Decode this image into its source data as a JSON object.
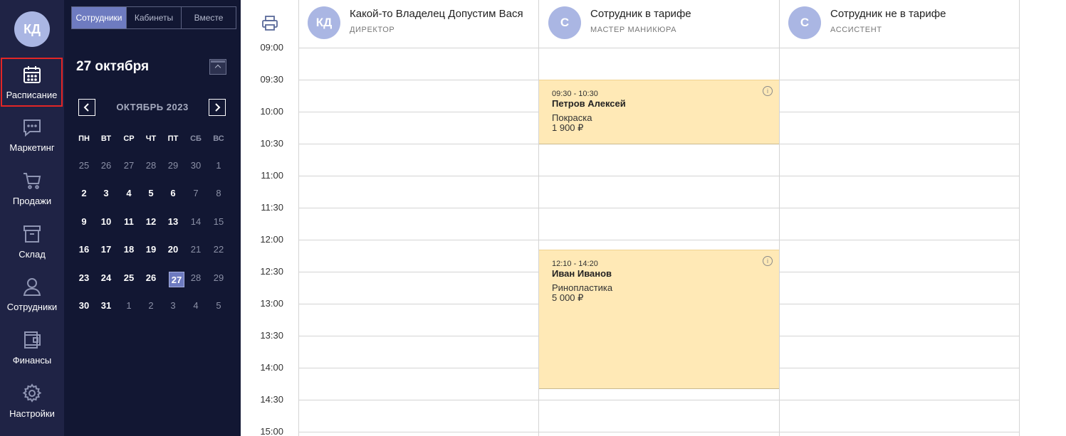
{
  "nav": {
    "avatar": "КД",
    "items": [
      {
        "label": "Расписание",
        "icon": "calendar-icon"
      },
      {
        "label": "Маркетинг",
        "icon": "chat-icon"
      },
      {
        "label": "Продажи",
        "icon": "cart-icon"
      },
      {
        "label": "Склад",
        "icon": "archive-icon"
      },
      {
        "label": "Сотрудники",
        "icon": "person-icon"
      },
      {
        "label": "Финансы",
        "icon": "wallet-icon"
      },
      {
        "label": "Настройки",
        "icon": "gear-icon"
      }
    ],
    "active": "Расписание"
  },
  "panel": {
    "tabs": [
      "Сотрудники",
      "Кабинеты",
      "Вместе"
    ],
    "active_tab": "Сотрудники",
    "date_title": "27 октября",
    "month_label": "ОКТЯБРЬ 2023",
    "weekdays": [
      "ПН",
      "ВТ",
      "СР",
      "ЧТ",
      "ПТ",
      "СБ",
      "ВС"
    ],
    "weeks": [
      [
        "25",
        "26",
        "27",
        "28",
        "29",
        "30",
        "1"
      ],
      [
        "2",
        "3",
        "4",
        "5",
        "6",
        "7",
        "8"
      ],
      [
        "9",
        "10",
        "11",
        "12",
        "13",
        "14",
        "15"
      ],
      [
        "16",
        "17",
        "18",
        "19",
        "20",
        "21",
        "22"
      ],
      [
        "23",
        "24",
        "25",
        "26",
        "27",
        "28",
        "29"
      ],
      [
        "30",
        "31",
        "1",
        "2",
        "3",
        "4",
        "5"
      ]
    ],
    "selected_day": "27"
  },
  "schedule": {
    "times": [
      "09:00",
      "09:30",
      "10:00",
      "10:30",
      "11:00",
      "11:30",
      "12:00",
      "12:30",
      "13:00",
      "13:30",
      "14:00",
      "14:30",
      "15:00"
    ],
    "employees": [
      {
        "initials": "КД",
        "name": "Какой-то Владелец Допустим Вася",
        "role": "ДИРЕКТОР"
      },
      {
        "initials": "С",
        "name": "Сотрудник в тарифе",
        "role": "МАСТЕР МАНИКЮРА"
      },
      {
        "initials": "С",
        "name": "Сотрудник не в тарифе",
        "role": "АССИСТЕНТ"
      }
    ],
    "appointments": [
      {
        "time": "09:30 - 10:30",
        "client": "Петров Алексей",
        "service": "Покраска",
        "price": "1 900 ₽",
        "info": "i"
      },
      {
        "time": "12:10 - 14:20",
        "client": "Иван Иванов",
        "service": "Ринопластика",
        "price": "5 000 ₽",
        "info": "i"
      }
    ]
  },
  "colors": {
    "nav_bg": "#1f2345",
    "panel_bg": "#121733",
    "accent": "#6e7bc0",
    "avatar": "#aab6e3",
    "appointment": "#ffe9b6",
    "active_outline": "#e32626"
  }
}
